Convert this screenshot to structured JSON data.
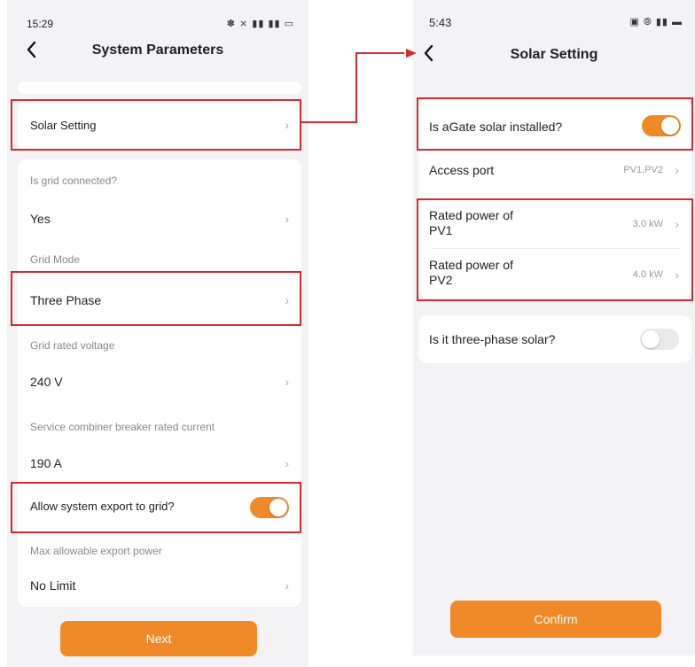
{
  "left": {
    "status": {
      "time": "15:29",
      "icons": "✽ ⨯ ▮▮ ▮▮ ▭"
    },
    "title": "System Parameters",
    "solar_setting": "Solar Setting",
    "grid_connected_label": "Is grid connected?",
    "grid_connected_value": "Yes",
    "grid_mode_label": "Grid Mode",
    "grid_mode_value": "Three Phase",
    "grid_voltage_label": "Grid rated voltage",
    "grid_voltage_value": "240 V",
    "breaker_label": "Service combiner breaker rated current",
    "breaker_value": "190 A",
    "export_label": "Allow system export to grid?",
    "export_on": true,
    "max_export_label": "Max allowable export power",
    "max_export_value": "No Limit",
    "next": "Next"
  },
  "right": {
    "status": {
      "time": "5:43",
      "icons": "▣ ⦾ ▮▮ ▬"
    },
    "title": "Solar Setting",
    "solar_installed_label": "Is aGate solar installed?",
    "solar_installed_on": true,
    "access_port_label": "Access port",
    "access_port_value": "PV1,PV2",
    "pv1_label_1": "Rated power of",
    "pv1_label_2": "PV1",
    "pv1_value": "3.0 kW",
    "pv2_label_1": "Rated power of",
    "pv2_label_2": "PV2",
    "pv2_value": "4.0 kW",
    "three_phase_label": "Is it three-phase solar?",
    "three_phase_on": false,
    "confirm": "Confirm"
  },
  "colors": {
    "accent": "#f08a28",
    "highlight": "#d42a2a",
    "background": "#f3f3f5"
  },
  "icons": {
    "back": "chevron-left-icon",
    "row_arrow": "chevron-right-icon"
  }
}
